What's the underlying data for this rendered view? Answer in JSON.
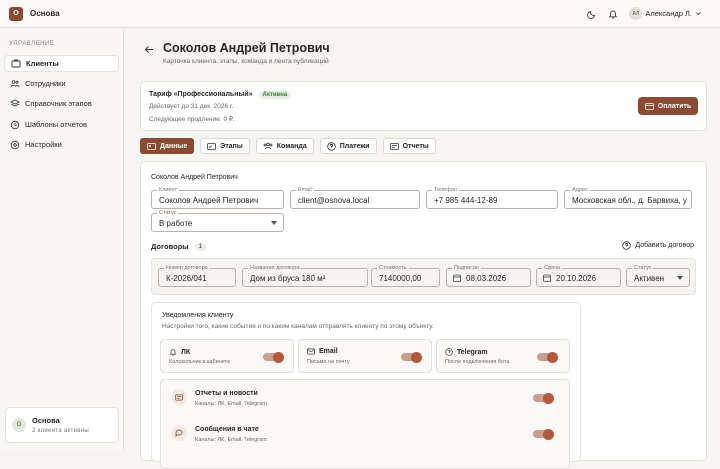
{
  "app": {
    "logo_letter": "О",
    "name": "Основа"
  },
  "user": {
    "initials": "АЛ",
    "name": "Александр Л."
  },
  "sidebar": {
    "section_title": "УПРАВЛЕНИЕ",
    "items": [
      {
        "label": "Клиенты",
        "icon": "clients-icon",
        "active": true
      },
      {
        "label": "Сотрудники",
        "icon": "staff-icon",
        "active": false
      },
      {
        "label": "Справочник этапов",
        "icon": "stages-icon",
        "active": false
      },
      {
        "label": "Шаблоны отчетов",
        "icon": "templates-icon",
        "active": false
      },
      {
        "label": "Настройки",
        "icon": "settings-icon",
        "active": false
      }
    ],
    "footer": {
      "avatar": "О",
      "title": "Основа",
      "subtitle": "2 клиента активны"
    }
  },
  "page": {
    "title": "Соколов Андрей Петрович",
    "subtitle": "Карточка клиента, этапы, команда и лента публикаций"
  },
  "plan": {
    "name": "Тариф «Профессиональный»",
    "badge": "Активна",
    "valid_until": "Действует до 31 дек. 2026 г.",
    "next_renewal": "Следующее продление: 0 ₽.",
    "pay_label": "Оплатить"
  },
  "tabs": [
    {
      "label": "Данные",
      "active": true
    },
    {
      "label": "Этапы",
      "active": false
    },
    {
      "label": "Команда",
      "active": false
    },
    {
      "label": "Платежи",
      "active": false
    },
    {
      "label": "Отчеты",
      "active": false
    }
  ],
  "client": {
    "section_label": "Соколов Андрей Петрович",
    "fields": {
      "name": {
        "label": "Клиент",
        "value": "Соколов Андрей Петрович"
      },
      "email": {
        "label": "Email",
        "value": "client@osnova.local"
      },
      "phone": {
        "label": "Телефон",
        "value": "+7 985 444-12-89"
      },
      "address": {
        "label": "Адрес",
        "value": "Московская обл., д. Барвиха, ул. Лесная"
      },
      "status": {
        "label": "Статус",
        "value": "В работе"
      }
    }
  },
  "contracts": {
    "title": "Договоры",
    "count": "1",
    "add_label": "Добавить договор",
    "row": {
      "number": {
        "label": "Номер договора",
        "value": "К-2026/041"
      },
      "name": {
        "label": "Название договора",
        "value": "Дом из бруса 180 м²"
      },
      "cost": {
        "label": "Стоимость",
        "value": "7140000,00"
      },
      "signed": {
        "label": "Подписан",
        "value": "08.03.2026"
      },
      "delivery": {
        "label": "Сдача",
        "value": "20.10.2026"
      },
      "status": {
        "label": "Статус",
        "value": "Активен"
      }
    }
  },
  "notifications": {
    "title": "Уведомления клиенту",
    "subtitle": "Настройки того, какие события и по каким каналам отправлять клиенту по этому объекту.",
    "channels": [
      {
        "name": "ЛК",
        "desc": "Колокольчик в кабинете",
        "icon": "bell-icon",
        "enabled": true
      },
      {
        "name": "Email",
        "desc": "Письмо на почту",
        "icon": "mail-icon",
        "enabled": true
      },
      {
        "name": "Telegram",
        "desc": "После подключения бота",
        "icon": "telegram-icon",
        "enabled": true
      }
    ],
    "events": [
      {
        "title": "Отчеты и новости",
        "channels": "Каналы: ЛК, Email, Telegram",
        "enabled": true
      },
      {
        "title": "Сообщения в чате",
        "channels": "Каналы: ЛК, Email, Telegram",
        "enabled": true
      }
    ]
  }
}
